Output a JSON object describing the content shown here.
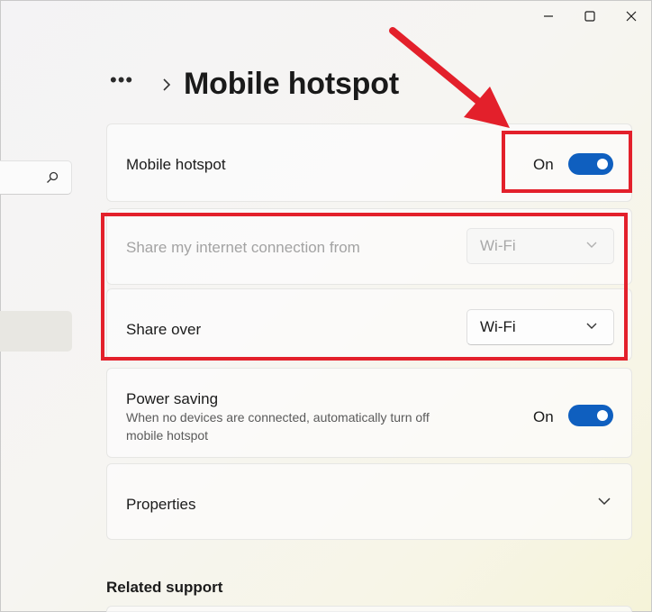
{
  "window": {
    "controls": {
      "minimize": "minimize",
      "maximize": "maximize",
      "close": "close"
    }
  },
  "breadcrumb": {
    "more": "•••",
    "title": "Mobile hotspot"
  },
  "hotspot_card": {
    "label": "Mobile hotspot",
    "state": "On",
    "toggle_on": true
  },
  "share_from": {
    "label": "Share my internet connection from",
    "value": "Wi-Fi",
    "disabled": true
  },
  "share_over": {
    "label": "Share over",
    "value": "Wi-Fi"
  },
  "power_saving": {
    "label": "Power saving",
    "description": "When no devices are connected, automatically turn off mobile hotspot",
    "state": "On",
    "toggle_on": true
  },
  "properties": {
    "label": "Properties"
  },
  "related_support": {
    "heading": "Related support"
  },
  "colors": {
    "accent": "#0f5fbf",
    "annotation_red": "#e3202b"
  },
  "icons": [
    "minimize-icon",
    "maximize-icon",
    "close-icon",
    "search-icon",
    "chevron-right-icon",
    "chevron-down-icon",
    "annotation-arrow"
  ]
}
